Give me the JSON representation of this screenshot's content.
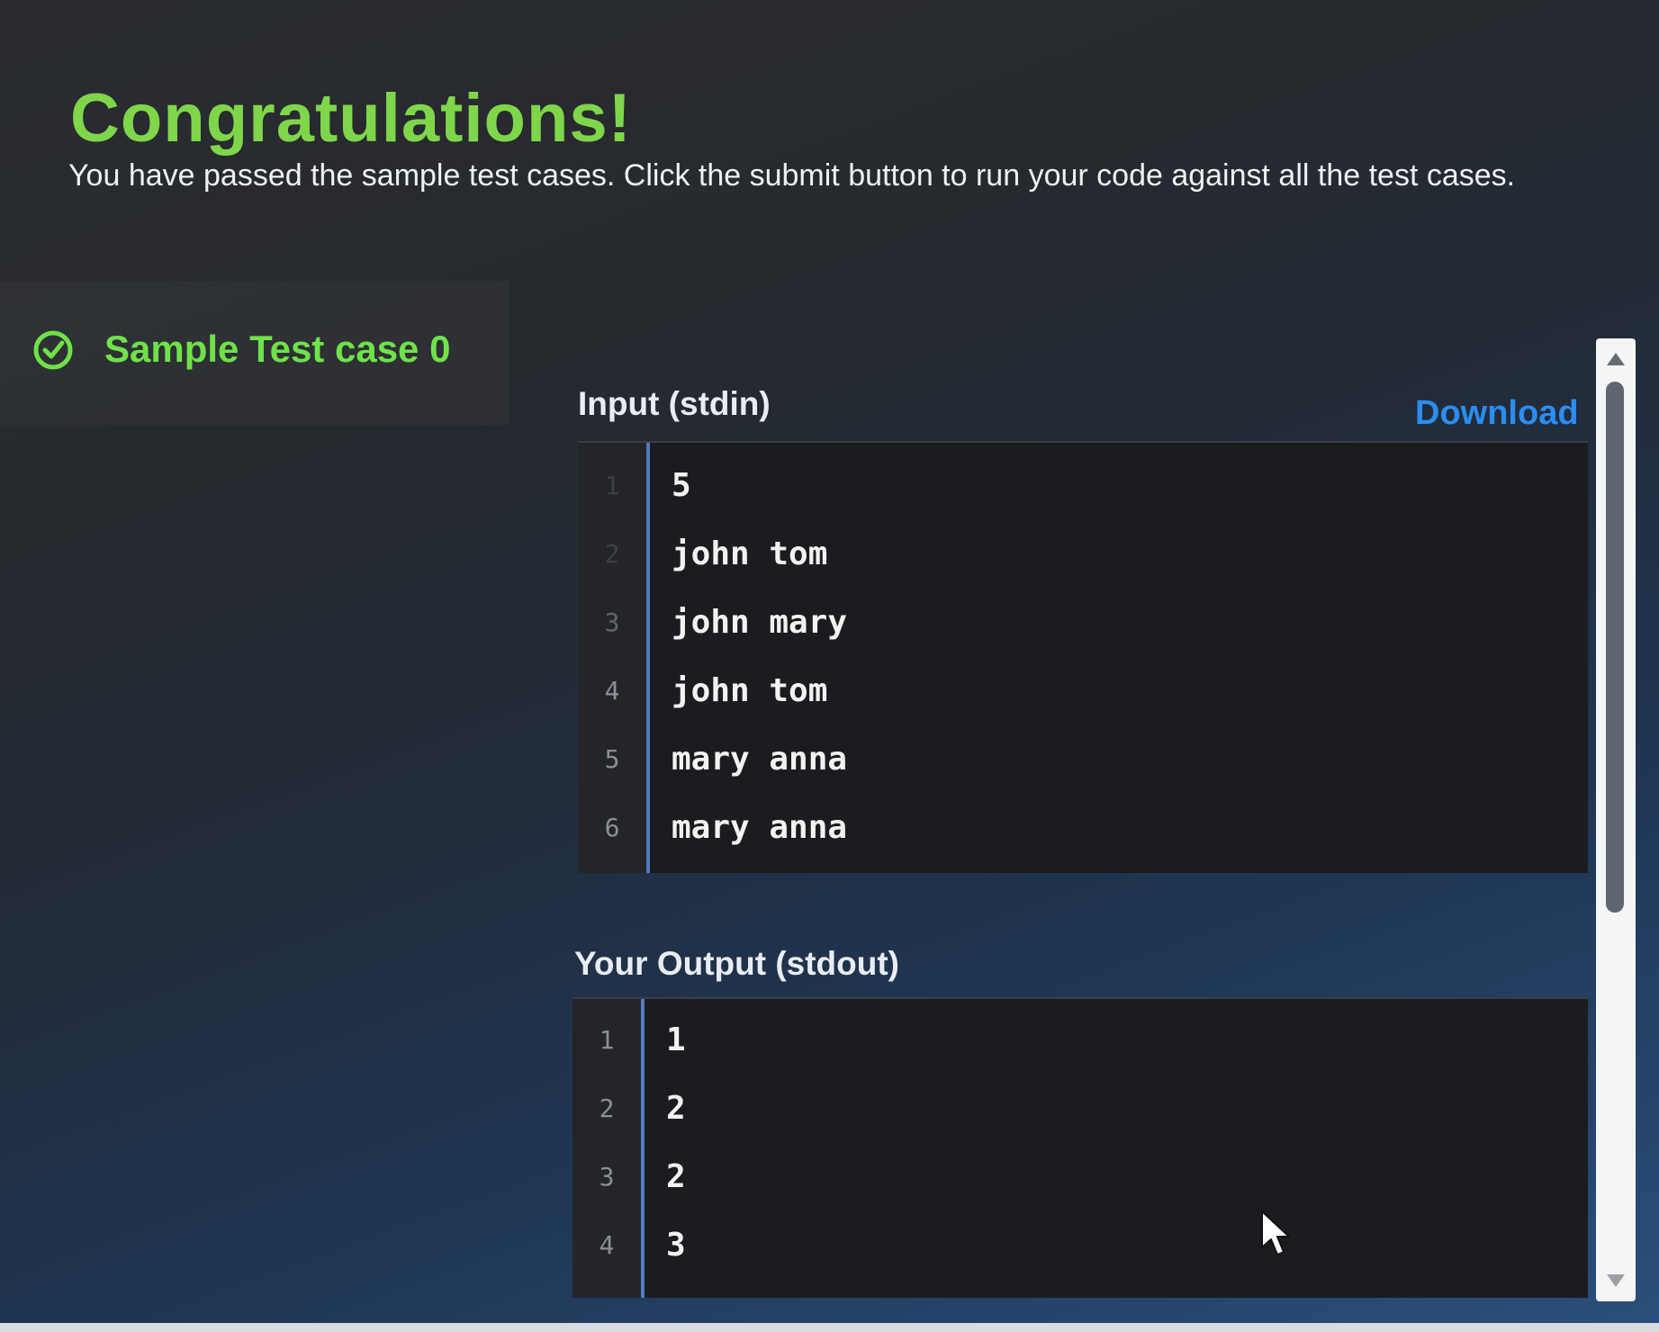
{
  "header": {
    "title": "Congratulations!",
    "message": "You have passed the sample test cases. Click the submit button to run your code against all the test cases."
  },
  "test_case": {
    "label": "Sample Test case 0",
    "status_icon": "check-circle-icon"
  },
  "input": {
    "title": "Input (stdin)",
    "download_label": "Download",
    "lines": [
      {
        "num": "1",
        "text": "5"
      },
      {
        "num": "2",
        "text": "john tom"
      },
      {
        "num": "3",
        "text": "john mary"
      },
      {
        "num": "4",
        "text": "john tom"
      },
      {
        "num": "5",
        "text": "mary anna"
      },
      {
        "num": "6",
        "text": "mary anna"
      }
    ]
  },
  "output": {
    "title": "Your Output (stdout)",
    "lines": [
      {
        "num": "1",
        "text": "1"
      },
      {
        "num": "2",
        "text": "2"
      },
      {
        "num": "3",
        "text": "2"
      },
      {
        "num": "4",
        "text": "3"
      }
    ]
  },
  "colors": {
    "success_green": "#7fd64b",
    "link_blue": "#2b8df0",
    "gutter_border": "#4f7cbf"
  }
}
